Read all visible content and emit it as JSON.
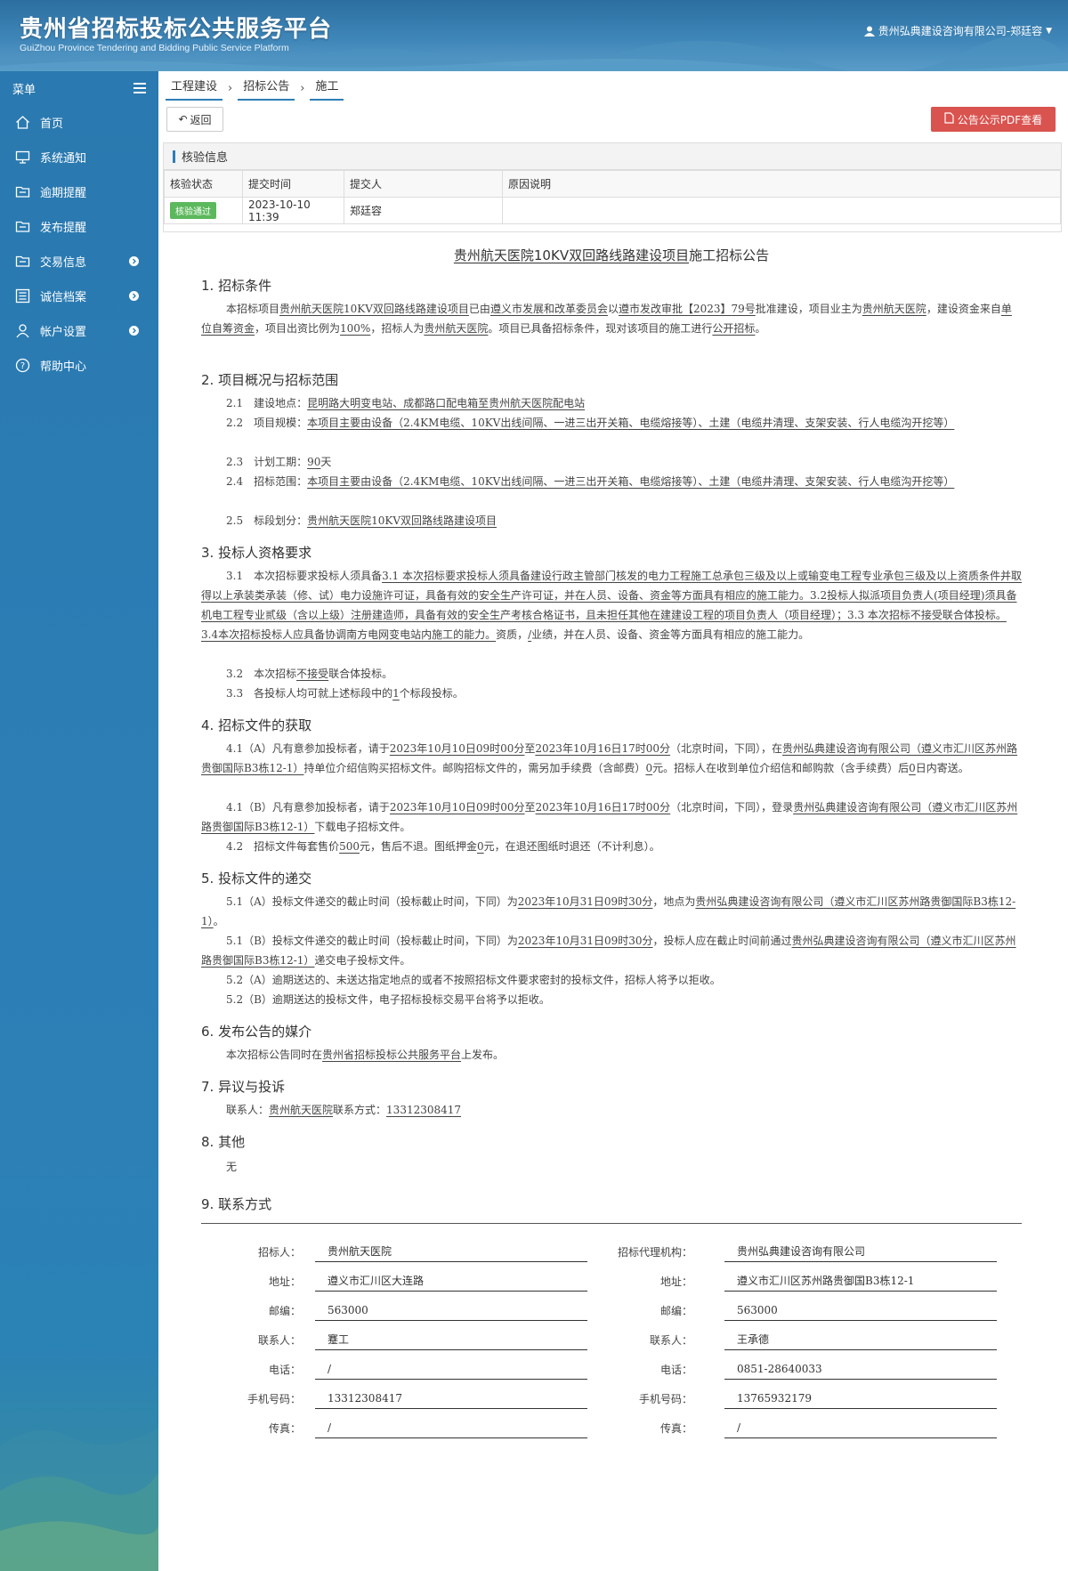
{
  "header": {
    "title": "贵州省招标投标公共服务平台",
    "subtitle": "GuiZhou Province Tendering and Bidding Public Service Platform",
    "user": "贵州弘典建设咨询有限公司-郑廷容"
  },
  "sidebar": {
    "menu_label": "菜单",
    "items": [
      {
        "label": "首页",
        "icon": "home-icon"
      },
      {
        "label": "系统通知",
        "icon": "monitor-icon"
      },
      {
        "label": "逾期提醒",
        "icon": "folder-icon"
      },
      {
        "label": "发布提醒",
        "icon": "folder-icon"
      },
      {
        "label": "交易信息",
        "icon": "folder-icon"
      },
      {
        "label": "诚信档案",
        "icon": "list-icon"
      },
      {
        "label": "帐户设置",
        "icon": "user-icon"
      },
      {
        "label": "帮助中心",
        "icon": "help-icon"
      }
    ]
  },
  "breadcrumb": [
    "工程建设",
    "招标公告",
    "施工"
  ],
  "buttons": {
    "back": "返回",
    "pdf": "公告公示PDF查看"
  },
  "verify": {
    "title": "核验信息",
    "headers": [
      "核验状态",
      "提交时间",
      "提交人",
      "原因说明"
    ],
    "status": "核验通过",
    "time": "2023-10-10 11:39",
    "submitter": "郑廷容",
    "reason": ""
  },
  "doc": {
    "title_project": "贵州航天医院10KV双回路线路建设项目",
    "title_suffix": "施工招标公告",
    "s1": "1. 招标条件",
    "s1p": [
      "本招标项目",
      "贵州航天医院10KV双回路线路建设项目",
      "已由",
      "遵义市发展和改革委员会",
      "以",
      "遵市发改审批【2023】79号",
      "批准建设，项目业主为",
      "贵州航天医院",
      "，建设资金来自",
      "单位自筹资金",
      "，项目出资比例为",
      "100%",
      "，招标人为",
      "贵州航天医院",
      "。项目已具备招标条件，现对该项目的施工进行",
      "公开招标",
      "。"
    ],
    "s2": "2. 项目概况与招标范围",
    "s2_1": [
      "2.1　建设地点：",
      "昆明路大明变电站、成都路口配电箱至贵州航天医院配电站"
    ],
    "s2_2": [
      "2.2　项目规模：",
      "本项目主要由设备（2.4KM电缆、10KV出线间隔、一进三出开关箱、电缆熔接等）、土建（电缆井清理、支架安装、行人电缆沟开挖等）"
    ],
    "s2_3": [
      "2.3　计划工期：",
      "90",
      "天"
    ],
    "s2_4": [
      "2.4　招标范围：",
      "本项目主要由设备（2.4KM电缆、10KV出线间隔、一进三出开关箱、电缆熔接等）、土建（电缆井清理、支架安装、行人电缆沟开挖等）"
    ],
    "s2_5": [
      "2.5　标段划分：",
      "贵州航天医院10KV双回路线路建设项目"
    ],
    "s3": "3. 投标人资格要求",
    "s3_1": [
      "3.1　本次招标要求投标人须具备",
      "3.1 本次招标要求投标人须具备建设行政主管部门核发的电力工程施工总承包三级及以上或输变电工程专业承包三级及以上资质条件并取得以上承装类承装（修、试）电力设施许可证，具备有效的安全生产许可证，并在人员、设备、资金等方面具有相应的施工能力。3.2投标人拟派项目负责人(项目经理)须具备机电工程专业贰级（含以上级）注册建造师，具备有效的安全生产考核合格证书，且未担任其他在建建设工程的项目负责人（项目经理）；3.3 本次招标不接受联合体投标。 3.4本次招标投标人应具备协调南方电网变电站内施工的能力。",
      "资质，",
      "/",
      "业绩，并在人员、设备、资金等方面具有相应的施工能力。"
    ],
    "s3_2": [
      "3.2　本次招标",
      "不接受",
      "联合体投标。"
    ],
    "s3_3": [
      "3.3　各投标人均可就上述标段中的",
      "1",
      "个标段投标。"
    ],
    "s4": "4. 招标文件的获取",
    "s4_1a": [
      "4.1（A）凡有意参加投标者，请于",
      "2023年10月10日09时00分",
      "至",
      "2023年10月16日17时00分",
      "（北京时间，下同），在",
      "贵州弘典建设咨询有限公司（遵义市汇川区苏州路贵御国际B3栋12-1）",
      "持单位介绍信购买招标文件。邮购招标文件的，需另加手续费（含邮费）",
      "0",
      "元。招标人在收到单位介绍信和邮购款（含手续费）后",
      "0",
      "日内寄送。"
    ],
    "s4_1b": [
      "4.1（B）凡有意参加投标者，请于",
      "2023年10月10日09时00分",
      "至",
      "2023年10月16日17时00分",
      "（北京时间，下同），登录",
      "贵州弘典建设咨询有限公司（遵义市汇川区苏州路贵御国际B3栋12-1）",
      "下载电子招标文件。"
    ],
    "s4_2": [
      "4.2　招标文件每套售价",
      "500",
      "元，售后不退。图纸押金",
      "0",
      "元，在退还图纸时退还（不计利息）。"
    ],
    "s5": "5. 投标文件的递交",
    "s5_1a": [
      "5.1（A）投标文件递交的截止时间（投标截止时间，下同）为",
      "2023年10月31日09时30分",
      "，地点为",
      "贵州弘典建设咨询有限公司（遵义市汇川区苏州路贵御国际B3栋12-1）",
      "。"
    ],
    "s5_1b": [
      "5.1（B）投标文件递交的截止时间（投标截止时间，下同）为",
      "2023年10月31日09时30分",
      "，投标人应在截止时间前通过",
      "贵州弘典建设咨询有限公司（遵义市汇川区苏州路贵御国际B3栋12-1）",
      "递交电子投标文件。"
    ],
    "s5_2a": "5.2（A）逾期送达的、未送达指定地点的或者不按照招标文件要求密封的投标文件，招标人将予以拒收。",
    "s5_2b": "5.2（B）逾期送达的投标文件，电子招标投标交易平台将予以拒收。",
    "s6": "6. 发布公告的媒介",
    "s6p": [
      "本次招标公告同时在",
      "贵州省招标投标公共服务平台",
      "上发布。"
    ],
    "s7": "7. 异议与投诉",
    "s7p": [
      "联系人：",
      "贵州航天医院",
      "联系方式：",
      "13312308417"
    ],
    "s8": "8. 其他",
    "s8p": "无",
    "s9": "9. 联系方式",
    "left": {
      "labels": [
        "招标人：",
        "地址：",
        "邮编：",
        "联系人：",
        "电话：",
        "手机号码：",
        "传真："
      ],
      "values": [
        "贵州航天医院",
        "遵义市汇川区大连路",
        "563000",
        "蹇工",
        "/",
        "13312308417",
        "/"
      ]
    },
    "right": {
      "labels": [
        "招标代理机构：",
        "地址：",
        "邮编：",
        "联系人：",
        "电话：",
        "手机号码：",
        "传真："
      ],
      "values": [
        "贵州弘典建设咨询有限公司",
        "遵义市汇川区苏州路贵御国B3栋12-1",
        "563000",
        "王承德",
        "0851-28640033",
        "13765932179",
        "/"
      ]
    }
  }
}
